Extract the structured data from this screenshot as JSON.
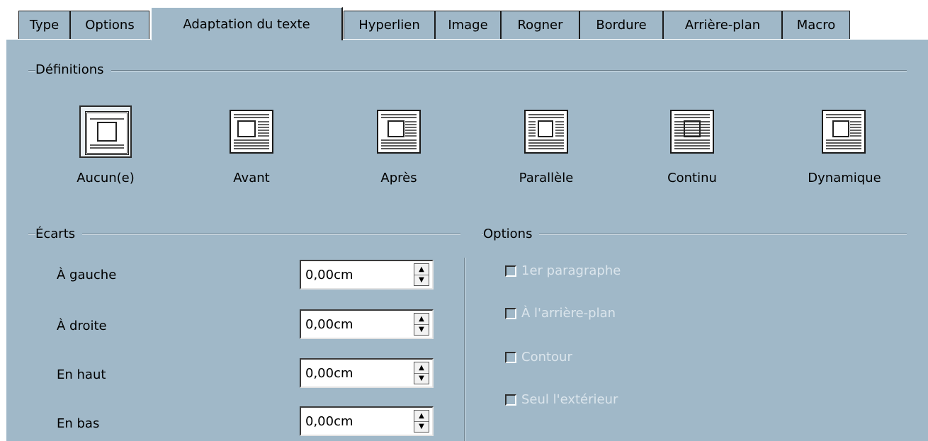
{
  "tabs": [
    {
      "label": "Type",
      "active": false
    },
    {
      "label": "Options",
      "active": false
    },
    {
      "label": "Adaptation du texte",
      "active": true
    },
    {
      "label": "Hyperlien",
      "active": false
    },
    {
      "label": "Image",
      "active": false
    },
    {
      "label": "Rogner",
      "active": false
    },
    {
      "label": "Bordure",
      "active": false
    },
    {
      "label": "Arrière-plan",
      "active": false
    },
    {
      "label": "Macro",
      "active": false
    }
  ],
  "definitions": {
    "title": "Définitions",
    "options": [
      {
        "id": "aucun",
        "label": "Aucun(e)",
        "mnemonic": "A",
        "selected": true
      },
      {
        "id": "avant",
        "label": "Avant",
        "mnemonic": "v",
        "selected": false
      },
      {
        "id": "apres",
        "label": "Après",
        "mnemonic": "A",
        "selected": false
      },
      {
        "id": "parallele",
        "label": "Parallèle",
        "mnemonic": "P",
        "selected": false
      },
      {
        "id": "continu",
        "label": "Continu",
        "mnemonic": "C",
        "selected": false
      },
      {
        "id": "dynamique",
        "label": "Dynamique",
        "mnemonic": "D",
        "selected": false
      }
    ]
  },
  "ecarts": {
    "title": "Écarts",
    "fields": [
      {
        "id": "gauche",
        "label": "À gauche",
        "value": "0,00cm"
      },
      {
        "id": "droite",
        "label": "À droite",
        "value": "0,00cm"
      },
      {
        "id": "haut",
        "label": "En haut",
        "value": "0,00cm"
      },
      {
        "id": "bas",
        "label": "En bas",
        "value": "0,00cm"
      }
    ]
  },
  "options": {
    "title": "Options",
    "checkboxes": [
      {
        "id": "premier-paragraphe",
        "label": "1er paragraphe",
        "checked": false,
        "enabled": false
      },
      {
        "id": "arriere-plan",
        "label": "À l'arrière-plan",
        "checked": false,
        "enabled": false
      },
      {
        "id": "contour",
        "label": "Contour",
        "checked": false,
        "enabled": false
      },
      {
        "id": "seul-exterieur",
        "label": "Seul l'extérieur",
        "checked": false,
        "enabled": false
      }
    ]
  },
  "colors": {
    "dialog_bg": "#a0b8c8",
    "disabled_text": "#dbe5ec",
    "field_bg": "#ffffff"
  }
}
